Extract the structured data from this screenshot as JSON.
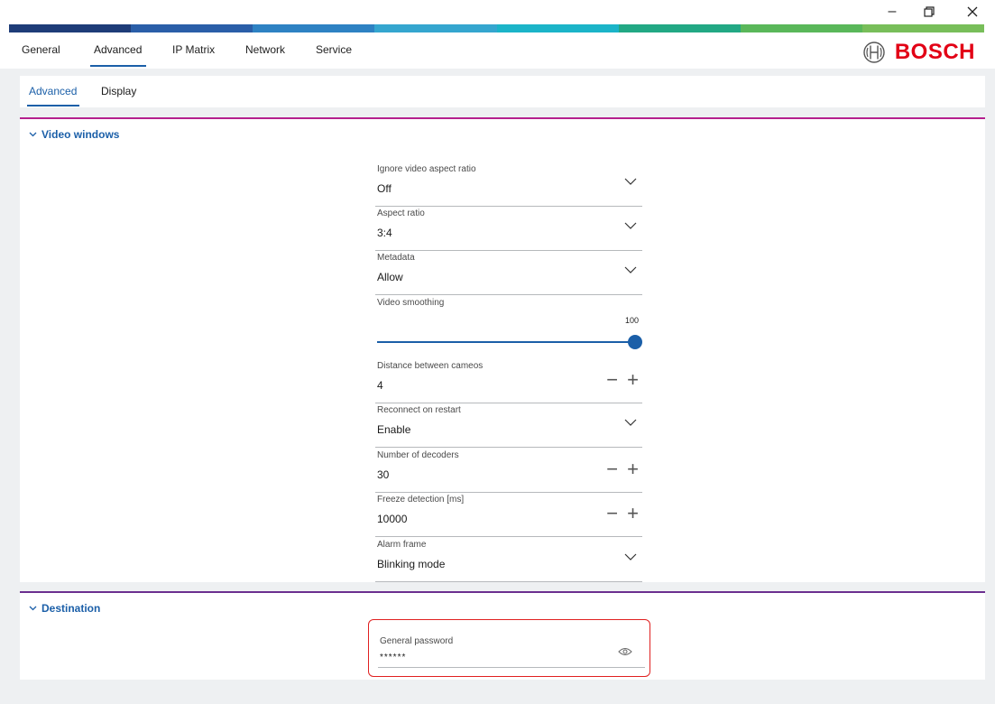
{
  "window": {
    "minimize_icon": "minimize-icon",
    "restore_icon": "restore-icon",
    "close_icon": "close-icon"
  },
  "brand": {
    "name": "BOSCH",
    "supergraphic_colors": [
      "#1e3c78",
      "#2a5ea8",
      "#2e82c3",
      "#35a6cf",
      "#1bb4c8",
      "#22a884",
      "#5ab75a",
      "#78be5a"
    ],
    "accent": "#1b5fa8",
    "section_line_video": "#b5208e",
    "section_line_dest": "#6b2f8f"
  },
  "top_tabs": [
    "General",
    "Advanced",
    "IP Matrix",
    "Network",
    "Service"
  ],
  "sub_tabs": [
    "Advanced",
    "Display"
  ],
  "video_windows": {
    "title": "Video windows",
    "fields": {
      "ignore_aspect": {
        "label": "Ignore video aspect ratio",
        "value": "Off"
      },
      "aspect_ratio": {
        "label": "Aspect ratio",
        "value": "3:4"
      },
      "metadata": {
        "label": "Metadata",
        "value": "Allow"
      },
      "video_smoothing": {
        "label": "Video smoothing",
        "value": "100",
        "level_percent": 100
      },
      "distance_cameos": {
        "label": "Distance between cameos",
        "value": "4"
      },
      "reconnect": {
        "label": "Reconnect on restart",
        "value": "Enable"
      },
      "num_decoders": {
        "label": "Number of decoders",
        "value": "30"
      },
      "freeze_detection": {
        "label": "Freeze detection [ms]",
        "value": "10000"
      },
      "alarm_frame": {
        "label": "Alarm frame",
        "value": "Blinking mode"
      }
    }
  },
  "destination": {
    "title": "Destination",
    "general_password": {
      "label": "General password",
      "value": "******"
    }
  }
}
